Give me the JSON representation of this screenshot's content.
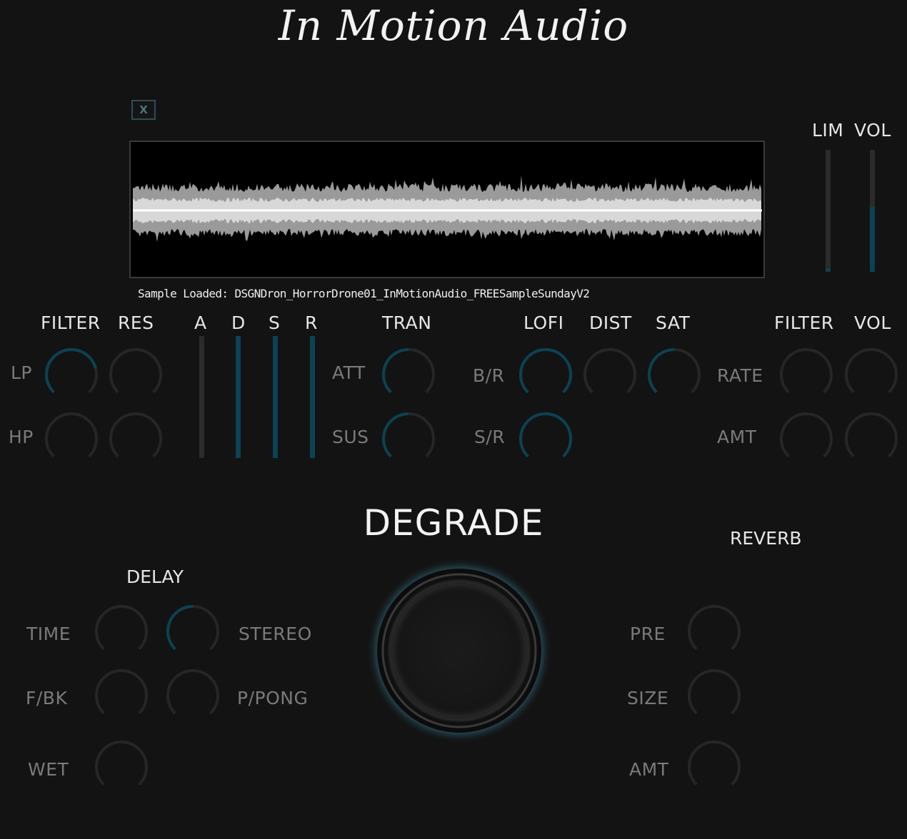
{
  "brand": {
    "logo_text": "In Motion Audio"
  },
  "sampler": {
    "close_label": "X",
    "sample_loaded": "Sample Loaded: DSGNDron_HorrorDrone01_InMotionAudio_FREESampleSundayV2"
  },
  "meters": [
    {
      "label": "LIM",
      "level": 0.03
    },
    {
      "label": "VOL",
      "level": 0.53
    }
  ],
  "filter_section": {
    "headers": [
      "FILTER",
      "RES"
    ],
    "rows": [
      "LP",
      "HP"
    ],
    "knobs": {
      "lp_filter": 0.78,
      "lp_res": 0.0,
      "hp_filter": 0.0,
      "hp_res": 0.0
    }
  },
  "envelope": {
    "labels": [
      "A",
      "D",
      "S",
      "R"
    ],
    "levels": [
      0.0,
      1.0,
      1.0,
      1.0
    ]
  },
  "transient": {
    "header": "TRAN",
    "rows": [
      "ATT",
      "SUS"
    ],
    "knobs": {
      "att": 0.5,
      "sus": 0.5
    }
  },
  "lofi": {
    "headers": [
      "LOFI",
      "DIST",
      "SAT"
    ],
    "rows": [
      "B/R",
      "S/R"
    ],
    "knobs": {
      "bitrate": 1.0,
      "dist": 0.0,
      "sat": 0.5,
      "samplerate": 1.0
    }
  },
  "lfo": {
    "headers": [
      "FILTER",
      "VOL"
    ],
    "rows": [
      "RATE",
      "AMT"
    ],
    "knobs": {
      "rate_filter": 0.0,
      "rate_vol": 0.0,
      "amt_filter": 0.0,
      "amt_vol": 0.0
    }
  },
  "main_title": "DEGRADE",
  "delay": {
    "title": "DELAY",
    "left_labels": [
      "TIME",
      "F/BK",
      "WET"
    ],
    "right_labels": [
      "STEREO",
      "P/PONG"
    ],
    "knobs": {
      "time": 0.0,
      "stereo": 0.5,
      "fbk": 0.0,
      "ppong": 0.0,
      "wet": 0.0
    }
  },
  "reverb": {
    "title": "REVERB",
    "labels": [
      "PRE",
      "SIZE",
      "AMT"
    ],
    "knobs": {
      "pre": 0.0,
      "size": 0.0,
      "amt": 0.0
    }
  },
  "colors": {
    "accent": "#0b4254",
    "track": "#262626",
    "glow": "#5fb4cf"
  }
}
